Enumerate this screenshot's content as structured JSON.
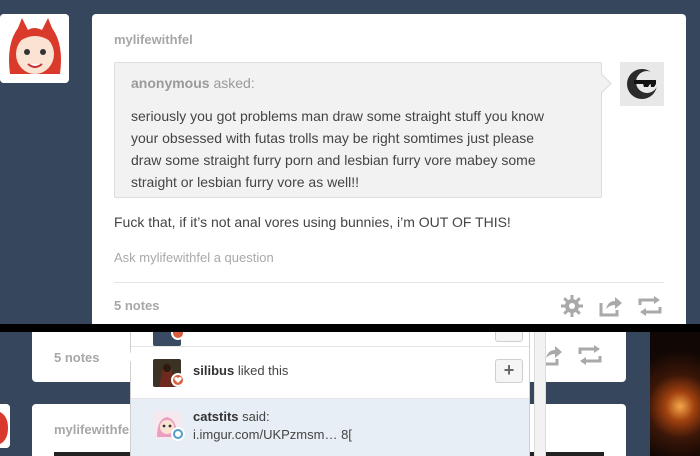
{
  "post": {
    "blog_name": "mylifewithfel",
    "asker": "anonymous",
    "asked_label": "asked:",
    "question_lines": [
      "seriously you got problems man draw some straight stuff you know",
      "your obsessed with futas trolls may be right somtimes just please",
      "draw some straight furry porn and lesbian furry vore mabey some",
      "straight or lesbian furry vore as well!!"
    ],
    "answer": "Fuck that, if it’s not anal vores using bunnies, i’m OUT OF THIS!",
    "ask_link": "Ask mylifewithfel a question",
    "notes": "5 notes"
  },
  "bottom": {
    "notes": "5 notes",
    "next_blog_name": "mylifewithfel",
    "notes_popover": [
      {
        "user": "silibus",
        "action": "liked this"
      },
      {
        "user": "catstits",
        "action": "said:",
        "reply": "i.imgur.com/UKPzmsm… 8["
      }
    ],
    "follow_label": "+"
  },
  "colors": {
    "dashboard_bg": "#36465d",
    "text_muted": "#a7a7a7",
    "like_red": "#d95e40",
    "reply_blue": "#529ecc"
  }
}
